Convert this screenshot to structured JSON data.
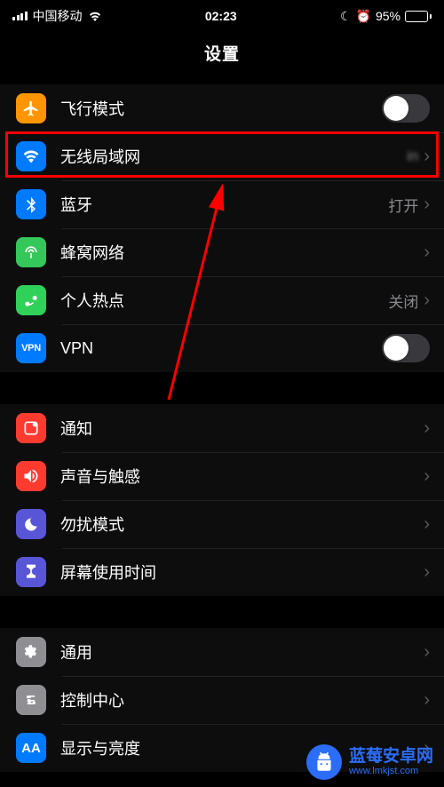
{
  "status": {
    "carrier": "中国移动",
    "time": "02:23",
    "battery_pct": "95%"
  },
  "title": "设置",
  "groups": [
    {
      "rows": [
        {
          "key": "airplane",
          "label": "飞行模式",
          "value": "",
          "type": "toggle",
          "on": false
        },
        {
          "key": "wifi",
          "label": "无线局域网",
          "value": "in",
          "type": "link",
          "obscured": true
        },
        {
          "key": "bluetooth",
          "label": "蓝牙",
          "value": "打开",
          "type": "link"
        },
        {
          "key": "cellular",
          "label": "蜂窝网络",
          "value": "",
          "type": "link"
        },
        {
          "key": "hotspot",
          "label": "个人热点",
          "value": "关闭",
          "type": "link"
        },
        {
          "key": "vpn",
          "label": "VPN",
          "value": "",
          "type": "toggle",
          "on": false
        }
      ]
    },
    {
      "rows": [
        {
          "key": "notifications",
          "label": "通知",
          "type": "link"
        },
        {
          "key": "sounds",
          "label": "声音与触感",
          "type": "link"
        },
        {
          "key": "dnd",
          "label": "勿扰模式",
          "type": "link"
        },
        {
          "key": "screentime",
          "label": "屏幕使用时间",
          "type": "link"
        }
      ]
    },
    {
      "rows": [
        {
          "key": "general",
          "label": "通用",
          "type": "link"
        },
        {
          "key": "controlcenter",
          "label": "控制中心",
          "type": "link"
        },
        {
          "key": "display",
          "label": "显示与亮度",
          "type": "link"
        }
      ]
    }
  ],
  "watermark": {
    "brand": "蓝莓安卓网",
    "url": "www.lmkjst.com"
  }
}
